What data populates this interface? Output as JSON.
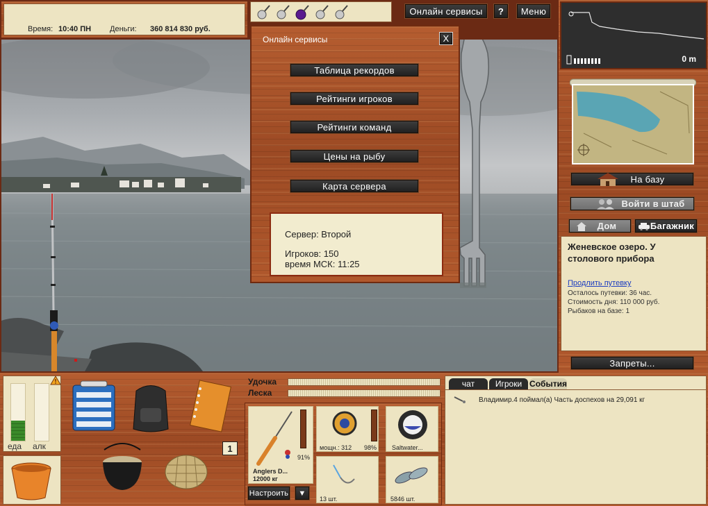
{
  "status": {
    "time_label": "Время:",
    "time_value": "10:40 ПН",
    "money_label": "Деньги:",
    "money_value": "360 814 830 руб."
  },
  "topbar": {
    "online_services_label": "Онлайн сервисы",
    "help_label": "?",
    "menu_label": "Меню"
  },
  "dialog": {
    "title": "Онлайн сервисы",
    "close_label": "X",
    "buttons": [
      "Таблица рекордов",
      "Рейтинги игроков",
      "Рейтинги команд",
      "Цены на рыбу",
      "Карта сервера"
    ],
    "server_line": "Сервер: Второй",
    "players_line": "Игроков: 150",
    "moscow_time_line": "время МСК: 11:25"
  },
  "sonar": {
    "depth": "0 m"
  },
  "nav": {
    "to_base": "На базу",
    "enter_hq": "Войти в штаб",
    "home": "Дом",
    "trunk": "Багажник",
    "bans": "Запреты..."
  },
  "location": {
    "title": "Женевское озеро. У столового прибора",
    "extend_link": "Продлить путевку",
    "remaining": "Осталось путевки: 36 час.",
    "daily_cost": "Стоимость дня: 110 000 руб.",
    "fishers": "Рыбаков на базе: 1"
  },
  "needs": {
    "food_label": "еда",
    "alcohol_label": "алк",
    "food_level": 0.35,
    "alcohol_level": 0.0
  },
  "inventory": {
    "badge": "1"
  },
  "tension": {
    "rod_label": "Удочка",
    "line_label": "Леска"
  },
  "rig": {
    "rod_name": "Anglers D...",
    "rod_capacity": "12000 кг",
    "rod_percent": "91%",
    "reel_power": "мощн.: 312",
    "reel_percent": "98%",
    "line_name": "Saltwater...",
    "hook_count": "13 шт.",
    "bait_count": "5846 шт.",
    "setup_button": "Настроить",
    "dropdown_icon": "▼"
  },
  "events": {
    "tabs": [
      "чат",
      "Игроки",
      "События"
    ],
    "active_tab": 2,
    "entries": [
      "Владимир.4 поймал(а) Часть доспехов на 29,091 кг"
    ]
  }
}
